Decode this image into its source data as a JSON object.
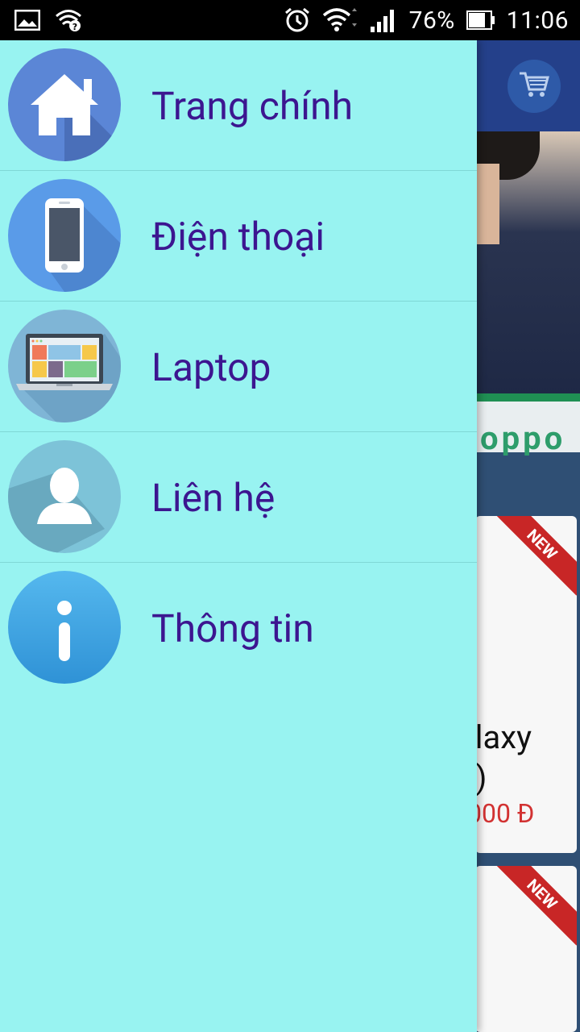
{
  "status_bar": {
    "battery_percent": "76%",
    "time": "11:06",
    "icons": [
      "image-notification-icon",
      "wifi-question-icon",
      "alarm-icon",
      "wifi-icon",
      "signal-icon",
      "battery-icon"
    ]
  },
  "app": {
    "banner_brand": "oppo",
    "products": [
      {
        "name_line1": "alaxy",
        "name_line2": "g)",
        "price": "000 Đ",
        "badge": "NEW"
      },
      {
        "badge": "NEW"
      }
    ]
  },
  "drawer": {
    "items": [
      {
        "label": "Trang chính",
        "icon": "home-icon"
      },
      {
        "label": "Điện thoại",
        "icon": "phone-icon"
      },
      {
        "label": "Laptop",
        "icon": "laptop-icon"
      },
      {
        "label": "Liên hệ",
        "icon": "contact-icon"
      },
      {
        "label": "Thông tin",
        "icon": "info-icon"
      }
    ]
  },
  "colors": {
    "drawer_bg": "#98f3f1",
    "label_color": "#3c1690",
    "toolbar": "#24408a"
  }
}
